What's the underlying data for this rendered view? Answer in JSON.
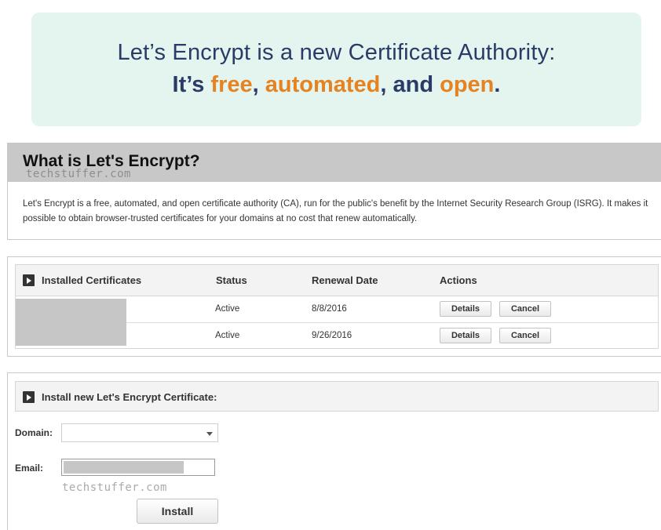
{
  "hero": {
    "line1": "Let’s Encrypt is a new Certificate Authority:",
    "line2_prefix": "It’s ",
    "word_free": "free",
    "comma1": ", ",
    "word_automated": "automated",
    "comma2": ", and ",
    "word_open": "open",
    "period": ".",
    "colors": {
      "text": "#2b3b67",
      "accent": "#e58323",
      "background": "#e3f5ee"
    }
  },
  "watermark": "techstuffer.com",
  "about": {
    "title": "What is Let's Encrypt?",
    "body": "Let's Encrypt is a free, automated, and open certificate authority (CA), run for the public's benefit by the Internet Security Research Group (ISRG). It makes it possible to obtain browser-trusted certificates for your domains at no cost that renew automatically."
  },
  "certificates": {
    "icon": "play-arrow-icon",
    "columns": [
      "Installed Certificates",
      "Status",
      "Renewal Date",
      "Actions"
    ],
    "rows": [
      {
        "status": "Active",
        "renewal_date": "8/8/2016",
        "details_label": "Details",
        "cancel_label": "Cancel"
      },
      {
        "status": "Active",
        "renewal_date": "9/26/2016",
        "details_label": "Details",
        "cancel_label": "Cancel"
      }
    ]
  },
  "install": {
    "icon": "play-arrow-icon",
    "title": "Install new Let's Encrypt Certificate:",
    "domain_label": "Domain:",
    "domain_value": "",
    "email_label": "Email:",
    "email_value": "",
    "button_label": "Install"
  }
}
